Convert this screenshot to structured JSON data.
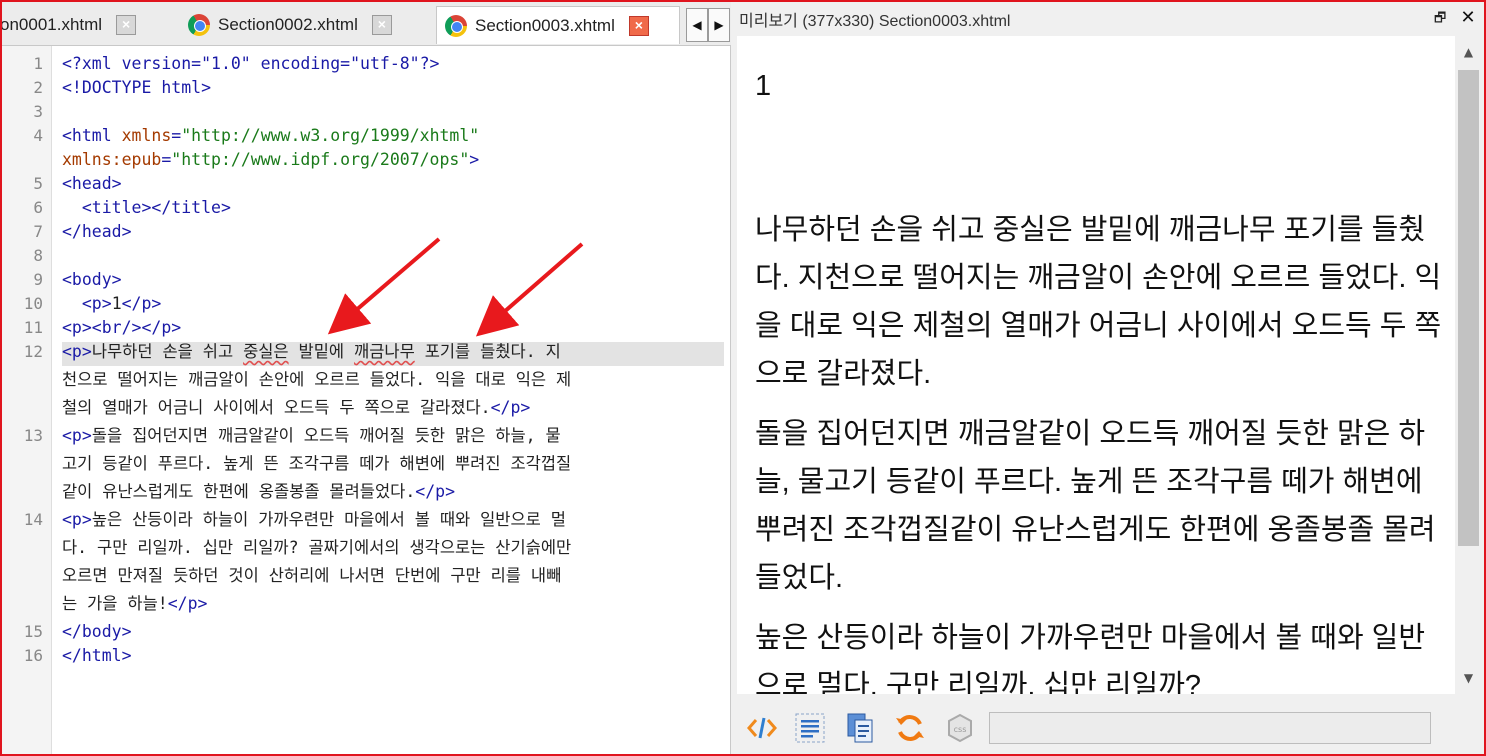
{
  "tabs": [
    {
      "label": "on0001.xhtml",
      "active": false
    },
    {
      "label": "Section0002.xhtml",
      "active": false
    },
    {
      "label": "Section0003.xhtml",
      "active": true
    }
  ],
  "tab_close_glyph": "×",
  "tab_nav": {
    "prev": "◀",
    "next": "▶"
  },
  "line_numbers": [
    "1",
    "2",
    "3",
    "4",
    "5",
    "6",
    "7",
    "8",
    "9",
    "10",
    "11",
    "12",
    "13",
    "14",
    "15",
    "16"
  ],
  "code": {
    "l1": {
      "pi": "<?xml version=\"1.0\" encoding=\"utf-8\"?>"
    },
    "l2": {
      "doctype": "<!DOCTYPE html>"
    },
    "l4a": {
      "open": "<html ",
      "attr": "xmlns",
      "eq": "=",
      "val": "\"http://www.w3.org/1999/xhtml\""
    },
    "l4b": {
      "attr": "xmlns:epub",
      "eq": "=",
      "val": "\"http://www.idpf.org/2007/ops\"",
      "close": ">"
    },
    "l5": "<head>",
    "l6": "  <title></title>",
    "l7": "</head>",
    "l9": "<body>",
    "l10": {
      "indent": "  ",
      "open": "<p>",
      "text": "1",
      "close": "</p>"
    },
    "l11": "<p><br/></p>",
    "l12": {
      "open": "<p>",
      "w1": "나무하던 손을 쉬고 ",
      "sq1": "중실은",
      "w2": " 발밑에 ",
      "sq2": "깨금나무",
      "w3": " 포기를 들췄다. 지",
      "c2": "천으로 떨어지는 깨금알이 손안에 오르르 들었다. 익을 대로 익은 제",
      "c3": "철의 열매가 어금니 사이에서 오드득 두 쪽으로 갈라졌다.",
      "close": "</p>"
    },
    "l13": {
      "open": "<p>",
      "c1": "돌을 집어던지면 깨금알같이 오드득 깨어질 듯한 맑은 하늘, 물",
      "c2": "고기 등같이 푸르다. 높게 뜬 조각구름 떼가 해변에 뿌려진 조각껍질",
      "c3": "같이 유난스럽게도 한편에 옹졸봉졸 몰려들었다.",
      "close": "</p>"
    },
    "l14": {
      "open": "<p>",
      "c1": "높은 산등이라 하늘이 가까우련만 마을에서 볼 때와 일반으로 멀",
      "c2": "다. 구만 리일까. 십만 리일까? 골짜기에서의 생각으로는 산기슭에만",
      "c3": "오르면 만져질 듯하던 것이 산허리에 나서면 단번에 구만 리를 내빼",
      "c4": "는 가을 하늘!",
      "close": "</p>"
    },
    "l15": "</body>",
    "l16": "</html>"
  },
  "preview": {
    "title": "미리보기 (377x330) Section0003.xhtml",
    "restore_glyph": "🗗",
    "close_glyph": "✕",
    "p1": "1",
    "p2": "나무하던 손을 쉬고 중실은 발밑에 깨금나무 포기를 들췄다. 지천으로 떨어지는 깨금알이 손안에 오르르 들었다. 익을 대로 익은 제철의 열매가 어금니 사이에서 오드득 두 쪽으로 갈라졌다.",
    "p3": "돌을 집어던지면 깨금알같이 오드득 깨어질 듯한 맑은 하늘, 물고기 등같이 푸르다. 높게 뜬 조각구름 떼가 해변에 뿌려진 조각껍질같이 유난스럽게도 한편에 옹졸봉졸 몰려들었다.",
    "p4": "높은 산등이라 하늘이 가까우련만 마을에서 볼 때와 일반으로 멀다. 구만 리일까. 십만 리일까?",
    "scroll_up": "▲",
    "scroll_down": "▼"
  },
  "colors": {
    "frame_border": "#e0141e",
    "tag": "#1a1aa6",
    "attribute": "#a43a00",
    "string": "#1a7a1a",
    "arrow": "#e8191d",
    "highlight_line": "#e3e3e3"
  },
  "toolbar_icons": [
    "code-view-icon",
    "text-lines-icon",
    "document-copy-icon",
    "refresh-icon",
    "css-icon"
  ]
}
